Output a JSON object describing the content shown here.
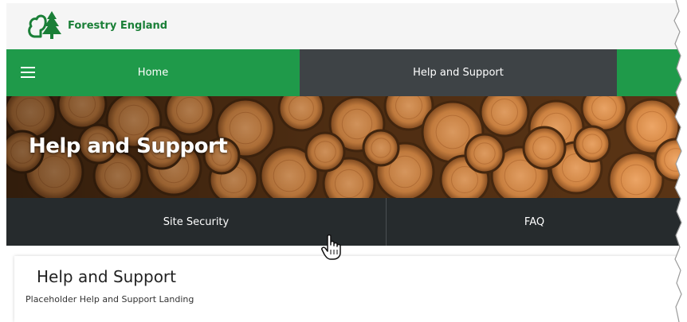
{
  "header": {
    "logo_text": "Forestry England",
    "logo_icon": "tree-logo-icon"
  },
  "nav": {
    "menu_icon": "hamburger-menu-icon",
    "home_label": "Home",
    "help_label": "Help and Support"
  },
  "hero": {
    "title": "Help and Support"
  },
  "sub_nav": {
    "items": [
      {
        "label": "Site Security"
      },
      {
        "label": "FAQ"
      }
    ]
  },
  "content": {
    "title": "Help and Support",
    "text": "Placeholder Help and Support Landing"
  },
  "colors": {
    "brand_green": "#1f9a4a",
    "nav_dark": "#3e4346",
    "sub_nav_dark": "#262b2d",
    "logo_green": "#1a7f37"
  }
}
